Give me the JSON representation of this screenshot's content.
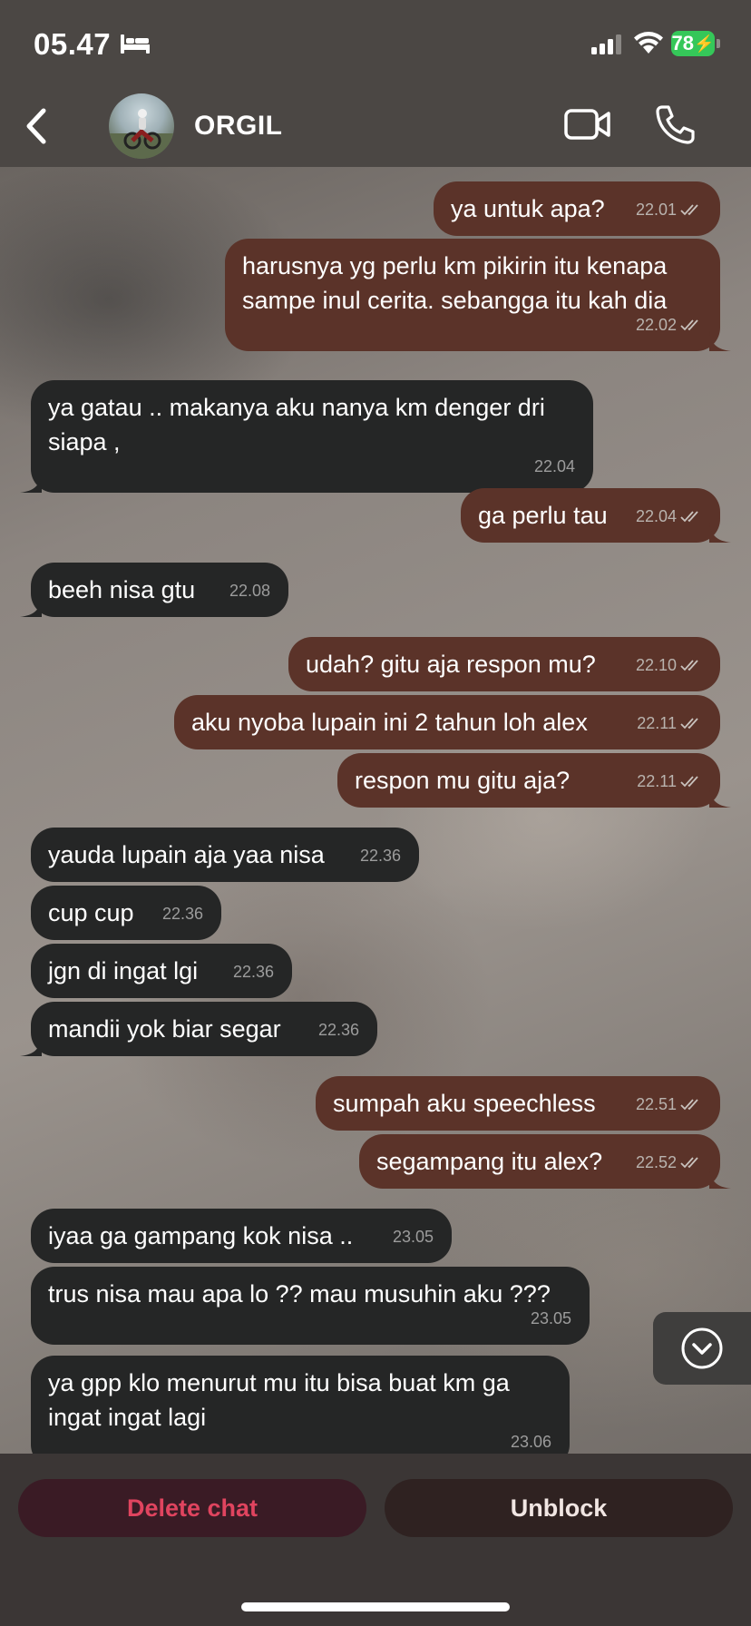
{
  "status_bar": {
    "time": "05.47",
    "battery": "78"
  },
  "header": {
    "contact_name": "ORGIL"
  },
  "messages": [
    {
      "dir": "out",
      "text": "ya untuk apa?",
      "time": "22.01"
    },
    {
      "dir": "out",
      "text": "harusnya yg perlu km pikirin itu kenapa\nsampe inul cerita. sebangga itu kah dia",
      "time": "22.02"
    },
    {
      "dir": "in",
      "text": "ya gatau .. makanya aku nanya km denger dri\nsiapa ,",
      "time": "22.04"
    },
    {
      "dir": "out",
      "text": "ga perlu tau",
      "time": "22.04"
    },
    {
      "dir": "in",
      "text": "beeh nisa gtu",
      "time": "22.08"
    },
    {
      "dir": "out",
      "text": "udah? gitu aja respon mu?",
      "time": "22.10"
    },
    {
      "dir": "out",
      "text": "aku nyoba lupain ini 2 tahun loh alex",
      "time": "22.11"
    },
    {
      "dir": "out",
      "text": "respon mu gitu aja?",
      "time": "22.11"
    },
    {
      "dir": "in",
      "text": "yauda lupain aja yaa nisa",
      "time": "22.36"
    },
    {
      "dir": "in",
      "text": "cup cup",
      "time": "22.36"
    },
    {
      "dir": "in",
      "text": "jgn di ingat lgi",
      "time": "22.36"
    },
    {
      "dir": "in",
      "text": "mandii yok biar segar",
      "time": "22.36"
    },
    {
      "dir": "out",
      "text": "sumpah aku speechless",
      "time": "22.51"
    },
    {
      "dir": "out",
      "text": "segampang itu alex?",
      "time": "22.52"
    },
    {
      "dir": "in",
      "text": "iyaa ga gampang kok nisa ..",
      "time": "23.05"
    },
    {
      "dir": "in",
      "text": "trus nisa mau apa lo ?? mau musuhin aku ???",
      "time": "23.05"
    },
    {
      "dir": "in",
      "text": "ya gpp klo menurut mu itu bisa buat km ga\ningat ingat lagi",
      "time": "23.06"
    }
  ],
  "actions": {
    "delete_label": "Delete chat",
    "unblock_label": "Unblock"
  },
  "colors": {
    "outgoing_bubble": "#5b3329",
    "incoming_bubble": "#252626",
    "delete_text": "#e0445f",
    "battery": "#35c759"
  }
}
